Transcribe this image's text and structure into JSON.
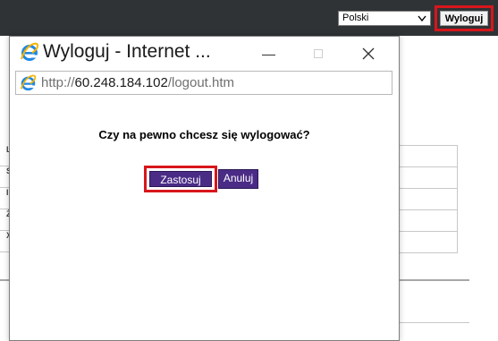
{
  "topbar": {
    "language_value": "Polski",
    "logout_label": "Wyloguj"
  },
  "background_table": {
    "left_letters": [
      "L",
      "S",
      "I",
      "Ż",
      "X"
    ]
  },
  "popup": {
    "title": "Wyloguj - Internet ...",
    "url_protocol": "http://",
    "url_host": "60.248.184.102",
    "url_path": "/logout.htm",
    "question": "Czy na pewno chcesz się wylogować?",
    "apply_label": "Zastosuj",
    "cancel_label": "Anuluj"
  },
  "colors": {
    "topbar": "#2f3336",
    "button_purple": "#4a2b86",
    "highlight_red": "#d8161b",
    "ie_blue": "#1e88e5"
  },
  "icons": {
    "browser": "internet-explorer-icon",
    "minimize": "minimize-icon",
    "maximize": "maximize-icon",
    "close": "close-icon",
    "dropdown": "chevron-down-icon"
  }
}
